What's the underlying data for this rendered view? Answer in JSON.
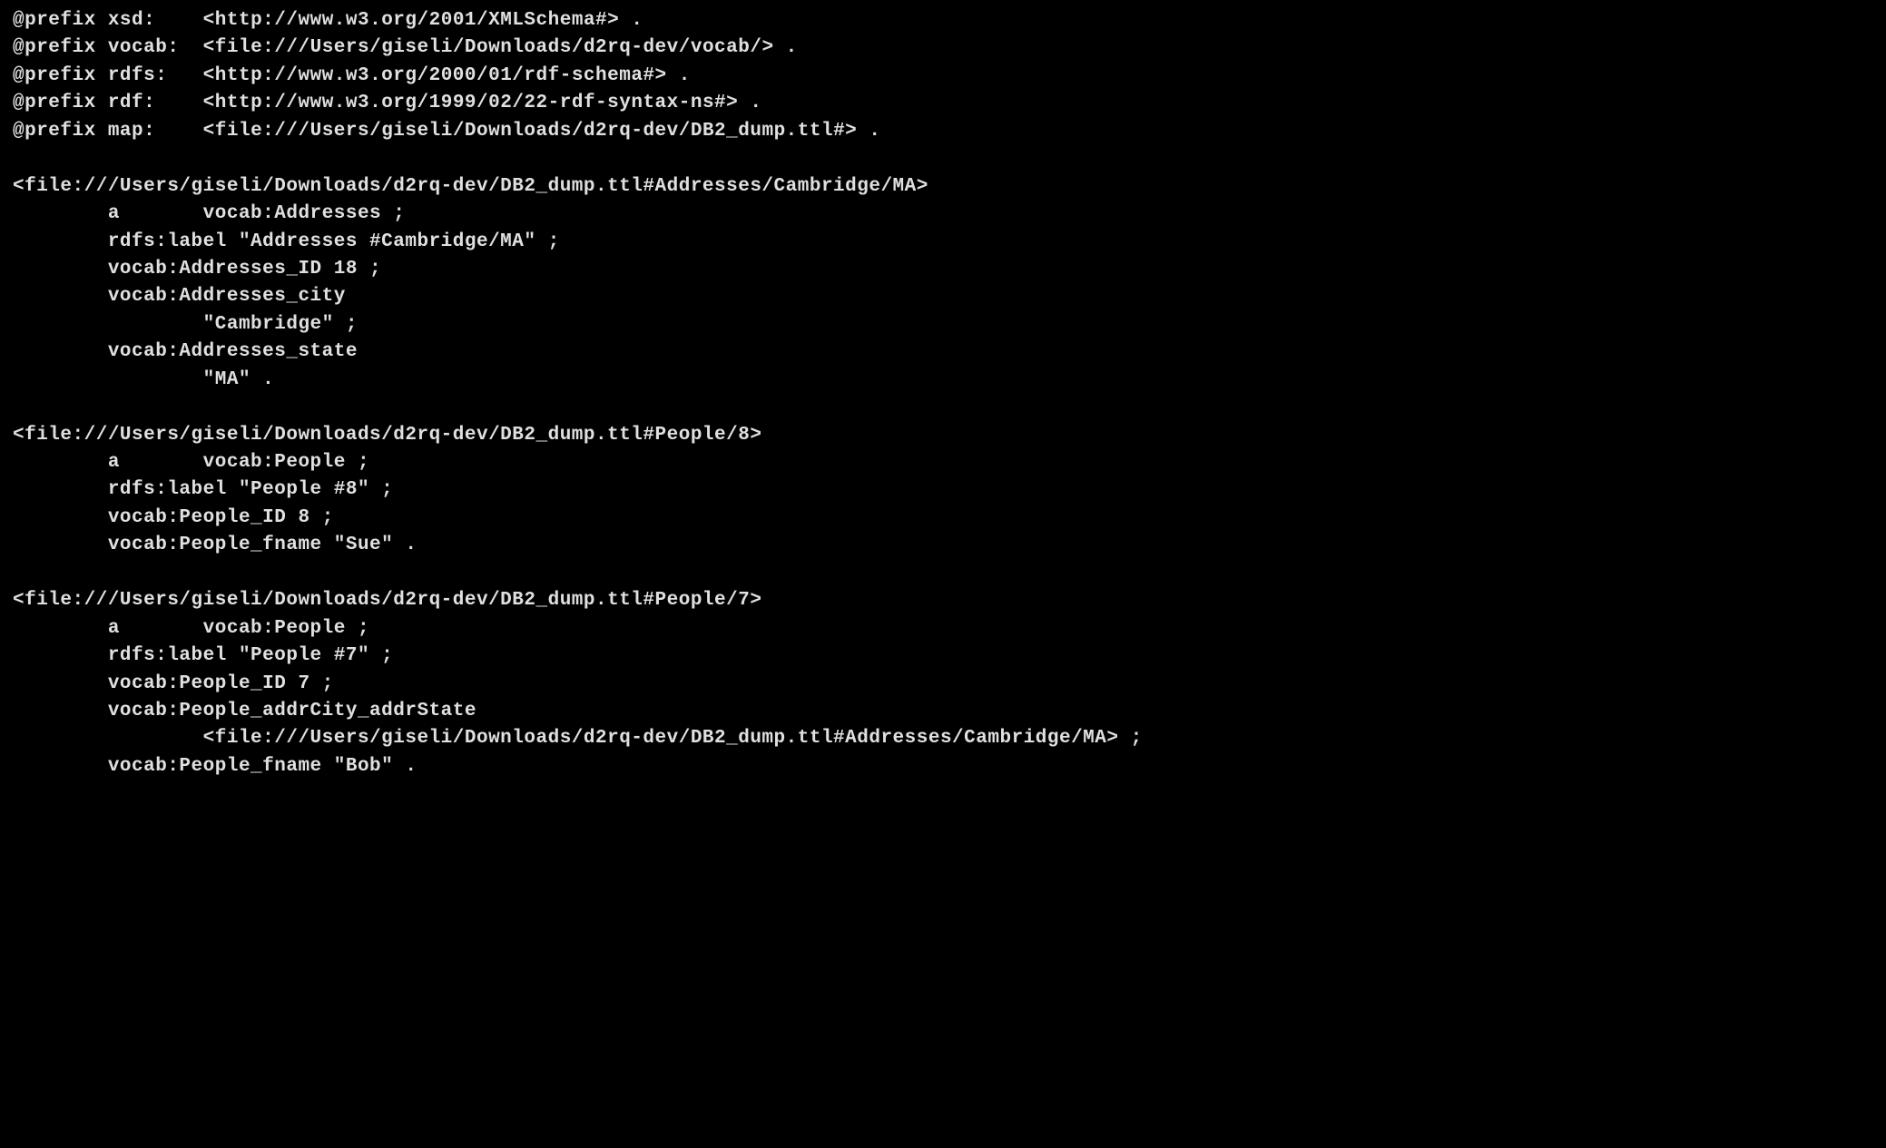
{
  "prefixes": [
    {
      "name": "xsd:",
      "iri": "<http://www.w3.org/2001/XMLSchema#> ."
    },
    {
      "name": "vocab:",
      "iri": "<file:///Users/giseli/Downloads/d2rq-dev/vocab/> ."
    },
    {
      "name": "rdfs:",
      "iri": "<http://www.w3.org/2000/01/rdf-schema#> ."
    },
    {
      "name": "rdf:",
      "iri": "<http://www.w3.org/1999/02/22-rdf-syntax-ns#> ."
    },
    {
      "name": "map:",
      "iri": "<file:///Users/giseli/Downloads/d2rq-dev/DB2_dump.ttl#> ."
    }
  ],
  "resources": [
    {
      "subject": "<file:///Users/giseli/Downloads/d2rq-dev/DB2_dump.ttl#Addresses/Cambridge/MA>",
      "lines": [
        "        a       vocab:Addresses ;",
        "        rdfs:label \"Addresses #Cambridge/MA\" ;",
        "        vocab:Addresses_ID 18 ;",
        "        vocab:Addresses_city",
        "                \"Cambridge\" ;",
        "        vocab:Addresses_state",
        "                \"MA\" ."
      ]
    },
    {
      "subject": "<file:///Users/giseli/Downloads/d2rq-dev/DB2_dump.ttl#People/8>",
      "lines": [
        "        a       vocab:People ;",
        "        rdfs:label \"People #8\" ;",
        "        vocab:People_ID 8 ;",
        "        vocab:People_fname \"Sue\" ."
      ]
    },
    {
      "subject": "<file:///Users/giseli/Downloads/d2rq-dev/DB2_dump.ttl#People/7>",
      "lines": [
        "        a       vocab:People ;",
        "        rdfs:label \"People #7\" ;",
        "        vocab:People_ID 7 ;",
        "        vocab:People_addrCity_addrState",
        "                <file:///Users/giseli/Downloads/d2rq-dev/DB2_dump.ttl#Addresses/Cambridge/MA> ;",
        "        vocab:People_fname \"Bob\" ."
      ]
    }
  ],
  "prefix_keyword": "@prefix"
}
